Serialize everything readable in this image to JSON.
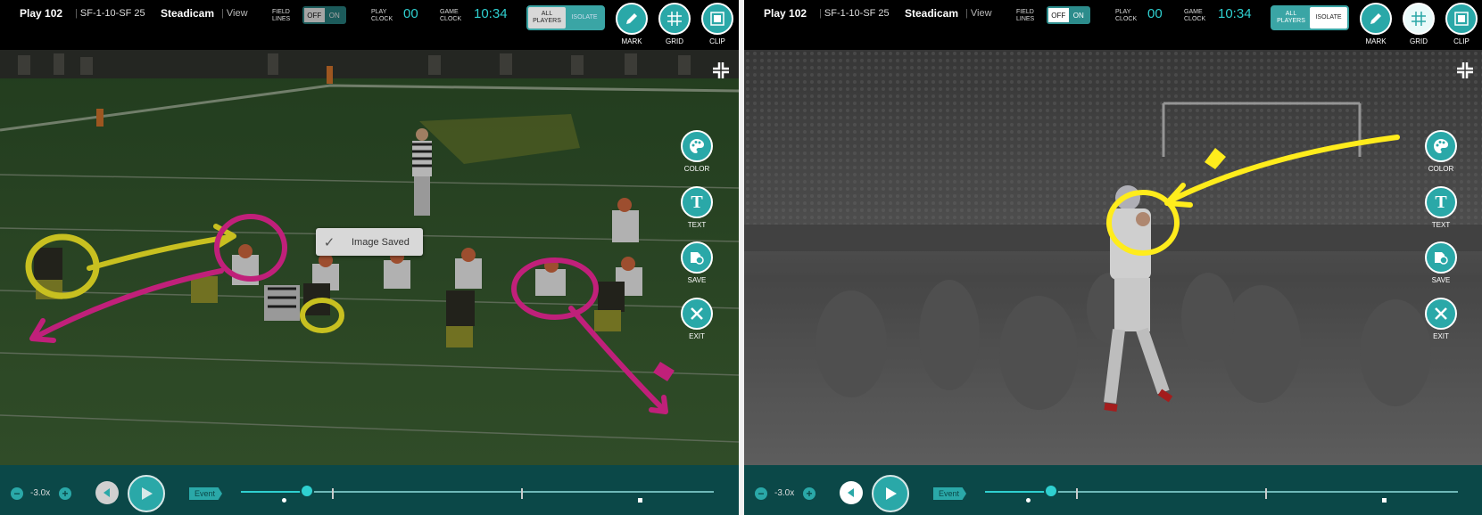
{
  "colors": {
    "accent": "#2aa8a8",
    "clock": "#2fd0d0",
    "yellow_draw": "#c8c020",
    "magenta_draw": "#c0207a",
    "bright_yellow": "#ffec1c"
  },
  "left": {
    "header": {
      "play_title": "Play 102",
      "play_id": "SF-1-10-SF 25",
      "camera": "Steadicam",
      "view_label": "View",
      "field_lines_label_1": "FIELD",
      "field_lines_label_2": "LINES",
      "toggle_off": "OFF",
      "toggle_on": "ON",
      "play_clock_label_1": "PLAY",
      "play_clock_label_2": "CLOCK",
      "play_clock_value": "00",
      "game_clock_label_1": "GAME",
      "game_clock_label_2": "CLOCK",
      "game_clock_value": "10:34",
      "seg_all_1": "ALL",
      "seg_all_2": "PLAYERS",
      "seg_isolate": "ISOLATE",
      "mark_label": "MARK",
      "grid_label": "GRID",
      "clip_label": "CLIP"
    },
    "side_tools": [
      {
        "label": "COLOR",
        "icon": "palette-icon"
      },
      {
        "label": "TEXT",
        "icon": "text-icon"
      },
      {
        "label": "SAVE",
        "icon": "save-icon"
      },
      {
        "label": "EXIT",
        "icon": "close-icon"
      }
    ],
    "toast": {
      "text": "Image Saved",
      "icon": "check-icon"
    },
    "playback": {
      "speed": "-3.0x",
      "event_label": "Event",
      "progress": 0.14
    }
  },
  "right": {
    "header": {
      "play_title": "Play 102",
      "play_id": "SF-1-10-SF 25",
      "camera": "Steadicam",
      "view_label": "View",
      "field_lines_label_1": "FIELD",
      "field_lines_label_2": "LINES",
      "toggle_off": "OFF",
      "toggle_on": "ON",
      "play_clock_label_1": "PLAY",
      "play_clock_label_2": "CLOCK",
      "play_clock_value": "00",
      "game_clock_label_1": "GAME",
      "game_clock_label_2": "CLOCK",
      "game_clock_value": "10:34",
      "seg_all_1": "ALL",
      "seg_all_2": "PLAYERS",
      "seg_isolate": "ISOLATE",
      "mark_label": "MARK",
      "grid_label": "GRID",
      "clip_label": "CLIP"
    },
    "side_tools": [
      {
        "label": "COLOR",
        "icon": "palette-icon"
      },
      {
        "label": "TEXT",
        "icon": "text-icon"
      },
      {
        "label": "SAVE",
        "icon": "save-icon"
      },
      {
        "label": "EXIT",
        "icon": "close-icon"
      }
    ],
    "playback": {
      "speed": "-3.0x",
      "event_label": "Event",
      "progress": 0.14
    }
  }
}
